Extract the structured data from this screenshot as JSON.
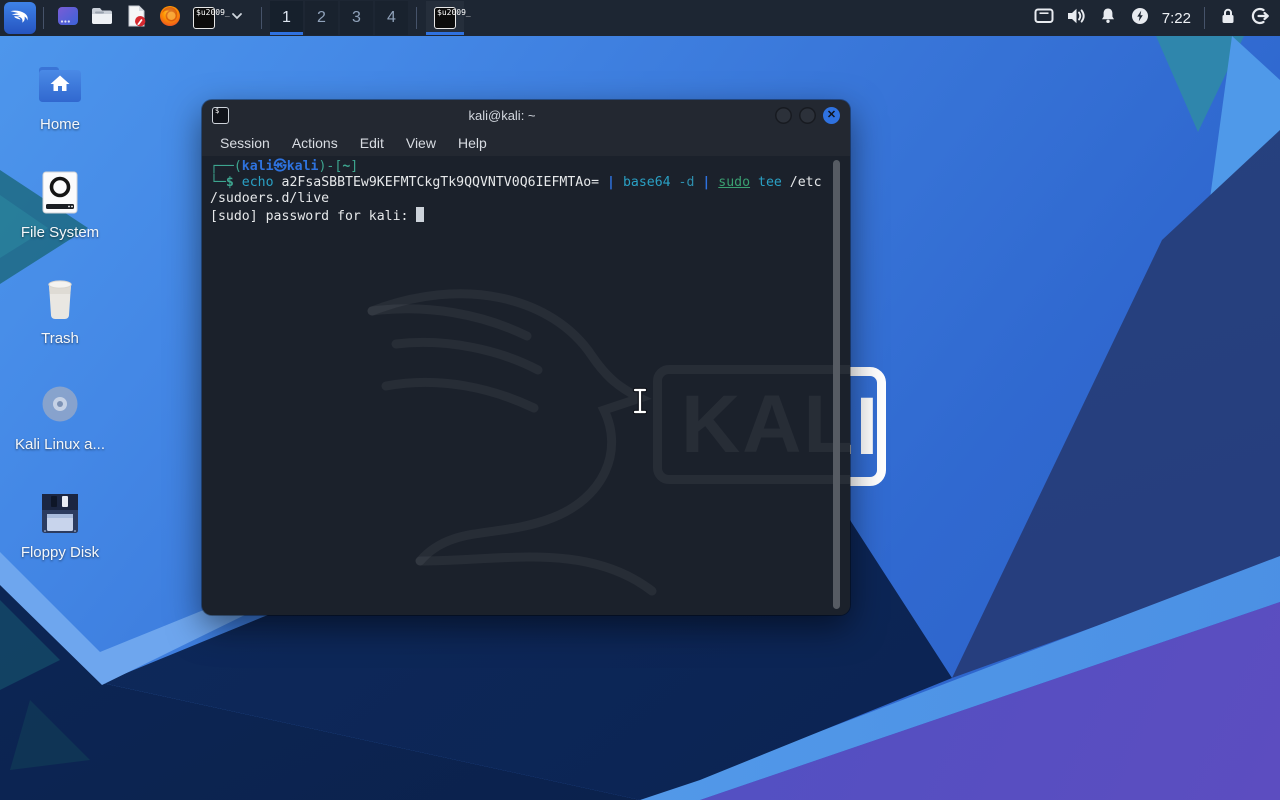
{
  "colors": {
    "accent": "#2f72e0",
    "panel-bg": "#1d2633",
    "terminal-bg": "#1b212b",
    "titlebar-bg": "#232831",
    "prompt-teal": "#3da58f",
    "prompt-blue": "#2e72de",
    "cmd-cyan": "#2aa0c4",
    "opt-cyan": "#2e8fae",
    "sudo-green": "#3aa071",
    "term-fg": "#e6e8ea"
  },
  "panel": {
    "launchers": [
      "kali-menu",
      "window-switcher",
      "file-manager",
      "text-editor",
      "firefox",
      "terminal"
    ],
    "workspaces": [
      "1",
      "2",
      "3",
      "4"
    ],
    "active_workspace": "1",
    "taskbar_items": [
      "terminal"
    ],
    "tray": [
      "display",
      "volume",
      "notifications",
      "power-manager"
    ],
    "clock": "7:22",
    "actions": [
      "lock",
      "logout"
    ]
  },
  "desktop": {
    "icons": [
      {
        "label": "Home"
      },
      {
        "label": "File System"
      },
      {
        "label": "Trash"
      },
      {
        "label": "Kali Linux a..."
      },
      {
        "label": "Floppy Disk"
      }
    ]
  },
  "wallpaper": {
    "wordmark": "KALI"
  },
  "terminal": {
    "title": "kali@kali: ~",
    "menu": [
      "Session",
      "Actions",
      "Edit",
      "View",
      "Help"
    ],
    "watermark": "KALI",
    "lines": [
      {
        "segments": [
          {
            "t": "┌──(",
            "c": "frame"
          },
          {
            "t": "kali㉿kali",
            "c": "user"
          },
          {
            "t": ")-[",
            "c": "frame"
          },
          {
            "t": "~",
            "c": "dir"
          },
          {
            "t": "]",
            "c": "frame"
          }
        ]
      },
      {
        "segments": [
          {
            "t": "└─",
            "c": "frame"
          },
          {
            "t": "$",
            "c": "dollar"
          },
          {
            "t": " ",
            "c": "plain"
          },
          {
            "t": "echo",
            "c": "cmd"
          },
          {
            "t": " a2FsaSBBTEw9KEFMTCkgTk9QQVNTV0Q6IEFMTAo= ",
            "c": "plain"
          },
          {
            "t": "|",
            "c": "pipe"
          },
          {
            "t": " ",
            "c": "plain"
          },
          {
            "t": "base64",
            "c": "cmd"
          },
          {
            "t": " ",
            "c": "plain"
          },
          {
            "t": "-d",
            "c": "opt"
          },
          {
            "t": " ",
            "c": "plain"
          },
          {
            "t": "|",
            "c": "pipe"
          },
          {
            "t": " ",
            "c": "plain"
          },
          {
            "t": "sudo",
            "c": "sudo"
          },
          {
            "t": " ",
            "c": "plain"
          },
          {
            "t": "tee",
            "c": "cmd"
          },
          {
            "t": " /etc",
            "c": "plain"
          }
        ]
      },
      {
        "segments": [
          {
            "t": "/sudoers.d/live",
            "c": "plain"
          }
        ]
      },
      {
        "segments": [
          {
            "t": "[sudo] password for kali: ",
            "c": "plain"
          }
        ],
        "cursor": true
      }
    ]
  }
}
